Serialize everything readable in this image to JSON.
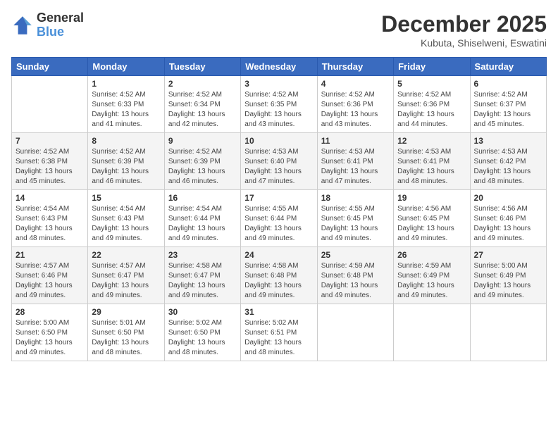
{
  "header": {
    "logo_line1": "General",
    "logo_line2": "Blue",
    "month": "December 2025",
    "location": "Kubuta, Shiselweni, Eswatini"
  },
  "columns": [
    "Sunday",
    "Monday",
    "Tuesday",
    "Wednesday",
    "Thursday",
    "Friday",
    "Saturday"
  ],
  "weeks": [
    [
      {
        "day": "",
        "sunrise": "",
        "sunset": "",
        "daylight": ""
      },
      {
        "day": "1",
        "sunrise": "Sunrise: 4:52 AM",
        "sunset": "Sunset: 6:33 PM",
        "daylight": "Daylight: 13 hours and 41 minutes."
      },
      {
        "day": "2",
        "sunrise": "Sunrise: 4:52 AM",
        "sunset": "Sunset: 6:34 PM",
        "daylight": "Daylight: 13 hours and 42 minutes."
      },
      {
        "day": "3",
        "sunrise": "Sunrise: 4:52 AM",
        "sunset": "Sunset: 6:35 PM",
        "daylight": "Daylight: 13 hours and 43 minutes."
      },
      {
        "day": "4",
        "sunrise": "Sunrise: 4:52 AM",
        "sunset": "Sunset: 6:36 PM",
        "daylight": "Daylight: 13 hours and 43 minutes."
      },
      {
        "day": "5",
        "sunrise": "Sunrise: 4:52 AM",
        "sunset": "Sunset: 6:36 PM",
        "daylight": "Daylight: 13 hours and 44 minutes."
      },
      {
        "day": "6",
        "sunrise": "Sunrise: 4:52 AM",
        "sunset": "Sunset: 6:37 PM",
        "daylight": "Daylight: 13 hours and 45 minutes."
      }
    ],
    [
      {
        "day": "7",
        "sunrise": "Sunrise: 4:52 AM",
        "sunset": "Sunset: 6:38 PM",
        "daylight": "Daylight: 13 hours and 45 minutes."
      },
      {
        "day": "8",
        "sunrise": "Sunrise: 4:52 AM",
        "sunset": "Sunset: 6:39 PM",
        "daylight": "Daylight: 13 hours and 46 minutes."
      },
      {
        "day": "9",
        "sunrise": "Sunrise: 4:52 AM",
        "sunset": "Sunset: 6:39 PM",
        "daylight": "Daylight: 13 hours and 46 minutes."
      },
      {
        "day": "10",
        "sunrise": "Sunrise: 4:53 AM",
        "sunset": "Sunset: 6:40 PM",
        "daylight": "Daylight: 13 hours and 47 minutes."
      },
      {
        "day": "11",
        "sunrise": "Sunrise: 4:53 AM",
        "sunset": "Sunset: 6:41 PM",
        "daylight": "Daylight: 13 hours and 47 minutes."
      },
      {
        "day": "12",
        "sunrise": "Sunrise: 4:53 AM",
        "sunset": "Sunset: 6:41 PM",
        "daylight": "Daylight: 13 hours and 48 minutes."
      },
      {
        "day": "13",
        "sunrise": "Sunrise: 4:53 AM",
        "sunset": "Sunset: 6:42 PM",
        "daylight": "Daylight: 13 hours and 48 minutes."
      }
    ],
    [
      {
        "day": "14",
        "sunrise": "Sunrise: 4:54 AM",
        "sunset": "Sunset: 6:43 PM",
        "daylight": "Daylight: 13 hours and 48 minutes."
      },
      {
        "day": "15",
        "sunrise": "Sunrise: 4:54 AM",
        "sunset": "Sunset: 6:43 PM",
        "daylight": "Daylight: 13 hours and 49 minutes."
      },
      {
        "day": "16",
        "sunrise": "Sunrise: 4:54 AM",
        "sunset": "Sunset: 6:44 PM",
        "daylight": "Daylight: 13 hours and 49 minutes."
      },
      {
        "day": "17",
        "sunrise": "Sunrise: 4:55 AM",
        "sunset": "Sunset: 6:44 PM",
        "daylight": "Daylight: 13 hours and 49 minutes."
      },
      {
        "day": "18",
        "sunrise": "Sunrise: 4:55 AM",
        "sunset": "Sunset: 6:45 PM",
        "daylight": "Daylight: 13 hours and 49 minutes."
      },
      {
        "day": "19",
        "sunrise": "Sunrise: 4:56 AM",
        "sunset": "Sunset: 6:45 PM",
        "daylight": "Daylight: 13 hours and 49 minutes."
      },
      {
        "day": "20",
        "sunrise": "Sunrise: 4:56 AM",
        "sunset": "Sunset: 6:46 PM",
        "daylight": "Daylight: 13 hours and 49 minutes."
      }
    ],
    [
      {
        "day": "21",
        "sunrise": "Sunrise: 4:57 AM",
        "sunset": "Sunset: 6:46 PM",
        "daylight": "Daylight: 13 hours and 49 minutes."
      },
      {
        "day": "22",
        "sunrise": "Sunrise: 4:57 AM",
        "sunset": "Sunset: 6:47 PM",
        "daylight": "Daylight: 13 hours and 49 minutes."
      },
      {
        "day": "23",
        "sunrise": "Sunrise: 4:58 AM",
        "sunset": "Sunset: 6:47 PM",
        "daylight": "Daylight: 13 hours and 49 minutes."
      },
      {
        "day": "24",
        "sunrise": "Sunrise: 4:58 AM",
        "sunset": "Sunset: 6:48 PM",
        "daylight": "Daylight: 13 hours and 49 minutes."
      },
      {
        "day": "25",
        "sunrise": "Sunrise: 4:59 AM",
        "sunset": "Sunset: 6:48 PM",
        "daylight": "Daylight: 13 hours and 49 minutes."
      },
      {
        "day": "26",
        "sunrise": "Sunrise: 4:59 AM",
        "sunset": "Sunset: 6:49 PM",
        "daylight": "Daylight: 13 hours and 49 minutes."
      },
      {
        "day": "27",
        "sunrise": "Sunrise: 5:00 AM",
        "sunset": "Sunset: 6:49 PM",
        "daylight": "Daylight: 13 hours and 49 minutes."
      }
    ],
    [
      {
        "day": "28",
        "sunrise": "Sunrise: 5:00 AM",
        "sunset": "Sunset: 6:50 PM",
        "daylight": "Daylight: 13 hours and 49 minutes."
      },
      {
        "day": "29",
        "sunrise": "Sunrise: 5:01 AM",
        "sunset": "Sunset: 6:50 PM",
        "daylight": "Daylight: 13 hours and 48 minutes."
      },
      {
        "day": "30",
        "sunrise": "Sunrise: 5:02 AM",
        "sunset": "Sunset: 6:50 PM",
        "daylight": "Daylight: 13 hours and 48 minutes."
      },
      {
        "day": "31",
        "sunrise": "Sunrise: 5:02 AM",
        "sunset": "Sunset: 6:51 PM",
        "daylight": "Daylight: 13 hours and 48 minutes."
      },
      {
        "day": "",
        "sunrise": "",
        "sunset": "",
        "daylight": ""
      },
      {
        "day": "",
        "sunrise": "",
        "sunset": "",
        "daylight": ""
      },
      {
        "day": "",
        "sunrise": "",
        "sunset": "",
        "daylight": ""
      }
    ]
  ]
}
